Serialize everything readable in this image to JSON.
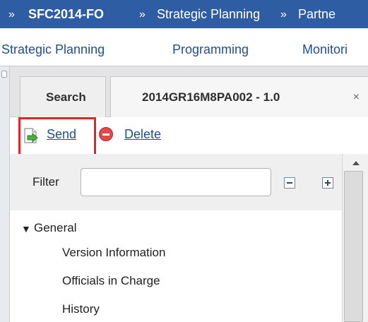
{
  "breadcrumb": {
    "separator": "»",
    "items": [
      "SFC2014-FO",
      "Strategic Planning",
      "Partne"
    ]
  },
  "menu": {
    "items": [
      "Strategic Planning",
      "Programming",
      "Monitori"
    ]
  },
  "tabs": [
    {
      "label": "Search"
    },
    {
      "label": "2014GR16M8PA002 - 1.0",
      "close_glyph": "×"
    }
  ],
  "actions": {
    "send_label": "Send",
    "delete_label": "Delete"
  },
  "filter": {
    "label": "Filter",
    "value": "",
    "placeholder": ""
  },
  "tree": {
    "group_label": "General",
    "items": [
      "Version Information",
      "Officials in Charge",
      "History"
    ]
  },
  "colors": {
    "header_bg": "#2f5da3",
    "link": "#1e4f91",
    "highlight": "#e32525"
  }
}
